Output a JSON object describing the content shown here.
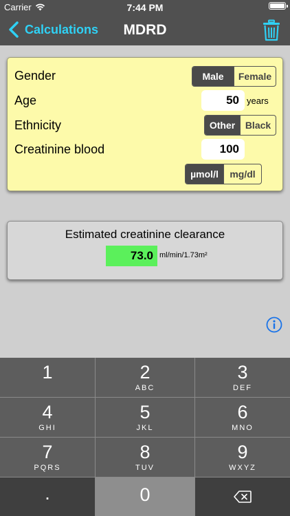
{
  "status_bar": {
    "carrier": "Carrier",
    "time": "7:44 PM"
  },
  "nav": {
    "back_label": "Calculations",
    "title": "MDRD"
  },
  "form": {
    "gender": {
      "label": "Gender",
      "options": [
        "Male",
        "Female"
      ],
      "selected": "Male"
    },
    "age": {
      "label": "Age",
      "value": "50",
      "unit": "years"
    },
    "ethnicity": {
      "label": "Ethnicity",
      "options": [
        "Other",
        "Black"
      ],
      "selected": "Other"
    },
    "creatinine": {
      "label": "Creatinine blood",
      "value": "100",
      "units": [
        "µmol/l",
        "mg/dl"
      ],
      "selected_unit": "µmol/l"
    }
  },
  "result": {
    "title": "Estimated creatinine clearance",
    "value": "73.0",
    "unit": "ml/min/1.73m²"
  },
  "keypad": {
    "keys": [
      {
        "digit": "1",
        "letters": ""
      },
      {
        "digit": "2",
        "letters": "ABC"
      },
      {
        "digit": "3",
        "letters": "DEF"
      },
      {
        "digit": "4",
        "letters": "GHI"
      },
      {
        "digit": "5",
        "letters": "JKL"
      },
      {
        "digit": "6",
        "letters": "MNO"
      },
      {
        "digit": "7",
        "letters": "PQRS"
      },
      {
        "digit": "8",
        "letters": "TUV"
      },
      {
        "digit": "9",
        "letters": "WXYZ"
      },
      {
        "digit": ".",
        "letters": ""
      },
      {
        "digit": "0",
        "letters": ""
      }
    ]
  },
  "colors": {
    "accent": "#2fd1f5",
    "card_bg": "#fdfaaa",
    "result_green": "#5bf05b",
    "info_blue": "#1a73e8"
  }
}
